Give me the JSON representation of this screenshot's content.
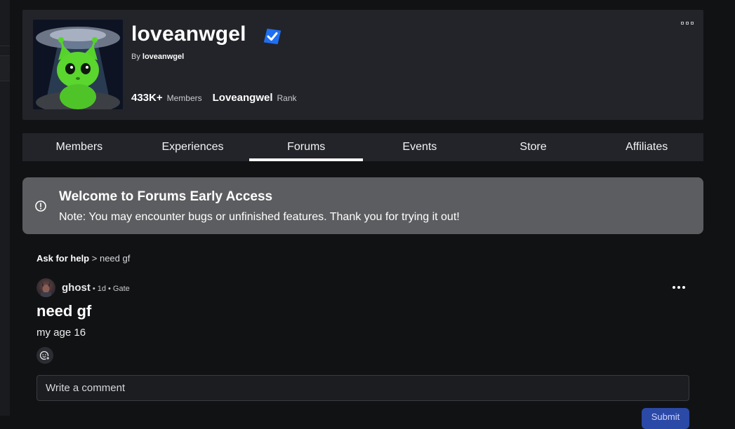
{
  "group": {
    "name": "loveanwgel",
    "by_label": "By",
    "owner": "loveanwgel",
    "members_count": "433K+",
    "members_label": "Members",
    "rank_value": "Loveangwel",
    "rank_label": "Rank"
  },
  "tabs": [
    {
      "label": "Members",
      "active": false
    },
    {
      "label": "Experiences",
      "active": false
    },
    {
      "label": "Forums",
      "active": true
    },
    {
      "label": "Events",
      "active": false
    },
    {
      "label": "Store",
      "active": false
    },
    {
      "label": "Affiliates",
      "active": false
    }
  ],
  "banner": {
    "title": "Welcome to Forums Early Access",
    "text": "Note: You may encounter bugs or unfinished features. Thank you for trying it out!"
  },
  "breadcrumb": {
    "category": "Ask for help",
    "separator": ">",
    "current": "need gf"
  },
  "post": {
    "author": "ghost",
    "age": "• 1d",
    "tag": "• Gate",
    "title": "need gf",
    "body": "my age 16"
  },
  "comment": {
    "placeholder": "Write a comment",
    "submit_label": "Submit"
  },
  "colors": {
    "background": "#111214",
    "card": "#232429",
    "banner": "#5c5d60",
    "verified": "#1f6ff2",
    "accent_button": "#2b49a6"
  },
  "icons": [
    "verified-check-icon",
    "more-icon",
    "info-icon",
    "add-reaction-icon"
  ]
}
